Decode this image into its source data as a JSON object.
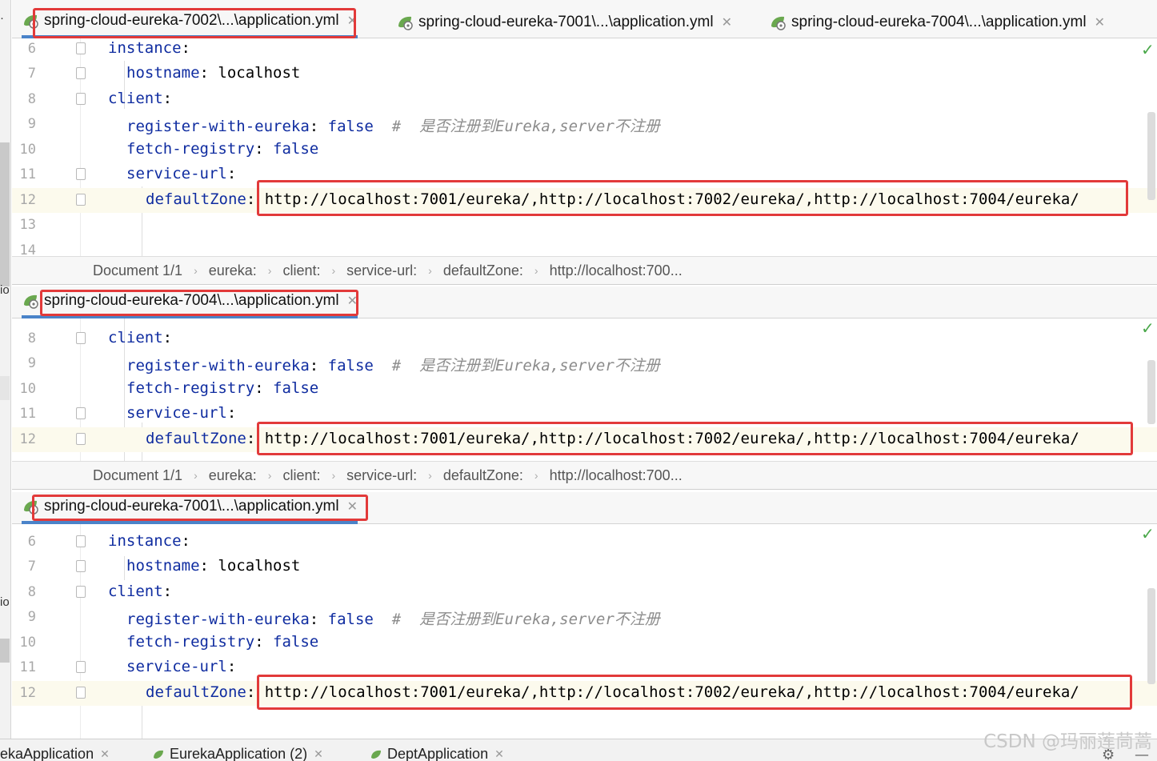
{
  "colors": {
    "highlight_box": "#e23a3a",
    "key": "#0f2ca0",
    "comment": "#8c8c8c",
    "active_tab_underline": "#4a83c9",
    "check": "#4aa84a"
  },
  "left_edge": {
    "frag1": "·",
    "frag2": "io",
    "frag3": "io"
  },
  "pane1": {
    "tabs": [
      {
        "label": "spring-cloud-eureka-7002\\...\\application.yml",
        "close": "✕",
        "icon": "spring-yml-icon"
      },
      {
        "label": "spring-cloud-eureka-7001\\...\\application.yml",
        "close": "✕",
        "icon": "spring-yml-icon"
      },
      {
        "label": "spring-cloud-eureka-7004\\...\\application.yml",
        "close": "✕",
        "icon": "spring-yml-icon"
      }
    ],
    "lines": [
      {
        "n": "6",
        "key": "instance",
        "colon": ":"
      },
      {
        "n": "7",
        "key": "hostname",
        "colon": ": ",
        "value": "localhost"
      },
      {
        "n": "8",
        "key": "client",
        "colon": ":"
      },
      {
        "n": "9",
        "key": "register-with-eureka",
        "colon": ": ",
        "value": "false",
        "comment": "#  是否注册到Eureka,server不注册"
      },
      {
        "n": "10",
        "key": "fetch-registry",
        "colon": ": ",
        "value": "false"
      },
      {
        "n": "11",
        "key": "service-url",
        "colon": ":"
      },
      {
        "n": "12",
        "key": "defaultZone",
        "colon": ": ",
        "value": "http://localhost:7001/eureka/,http://localhost:7002/eureka/,http://localhost:7004/eureka/"
      },
      {
        "n": "13"
      },
      {
        "n": "14"
      }
    ],
    "breadcrumb": [
      "Document 1/1",
      "eureka:",
      "client:",
      "service-url:",
      "defaultZone:",
      "http://localhost:700..."
    ],
    "check": "✓"
  },
  "pane2": {
    "tabs": [
      {
        "label": "spring-cloud-eureka-7004\\...\\application.yml",
        "close": "✕",
        "icon": "spring-yml-icon"
      }
    ],
    "lines": [
      {
        "n": "8",
        "key": "client",
        "colon": ":"
      },
      {
        "n": "9",
        "key": "register-with-eureka",
        "colon": ": ",
        "value": "false",
        "comment": "#  是否注册到Eureka,server不注册"
      },
      {
        "n": "10",
        "key": "fetch-registry",
        "colon": ": ",
        "value": "false"
      },
      {
        "n": "11",
        "key": "service-url",
        "colon": ":"
      },
      {
        "n": "12",
        "key": "defaultZone",
        "colon": ": ",
        "value": "http://localhost:7001/eureka/,http://localhost:7002/eureka/,http://localhost:7004/eureka/"
      }
    ],
    "breadcrumb": [
      "Document 1/1",
      "eureka:",
      "client:",
      "service-url:",
      "defaultZone:",
      "http://localhost:700..."
    ],
    "check": "✓"
  },
  "pane3": {
    "tabs": [
      {
        "label": "spring-cloud-eureka-7001\\...\\application.yml",
        "close": "✕",
        "icon": "spring-yml-icon"
      }
    ],
    "lines": [
      {
        "n": "6",
        "key": "instance",
        "colon": ":"
      },
      {
        "n": "7",
        "key": "hostname",
        "colon": ": ",
        "value": "localhost"
      },
      {
        "n": "8",
        "key": "client",
        "colon": ":"
      },
      {
        "n": "9",
        "key": "register-with-eureka",
        "colon": ": ",
        "value": "false",
        "comment": "#  是否注册到Eureka,server不注册"
      },
      {
        "n": "10",
        "key": "fetch-registry",
        "colon": ": ",
        "value": "false"
      },
      {
        "n": "11",
        "key": "service-url",
        "colon": ":"
      },
      {
        "n": "12",
        "key": "defaultZone",
        "colon": ": ",
        "value": "http://localhost:7001/eureka/,http://localhost:7002/eureka/,http://localhost:7004/eureka/"
      }
    ],
    "check": "✓"
  },
  "bottom_tabs": [
    {
      "label": "ekaApplication",
      "close": "✕"
    },
    {
      "label": "EurekaApplication (2)",
      "close": "✕"
    },
    {
      "label": "DeptApplication",
      "close": "✕"
    }
  ],
  "bottom_icons": {
    "gear": "⚙",
    "minus": "—"
  },
  "watermark": "CSDN @玛丽莲茼蒿"
}
